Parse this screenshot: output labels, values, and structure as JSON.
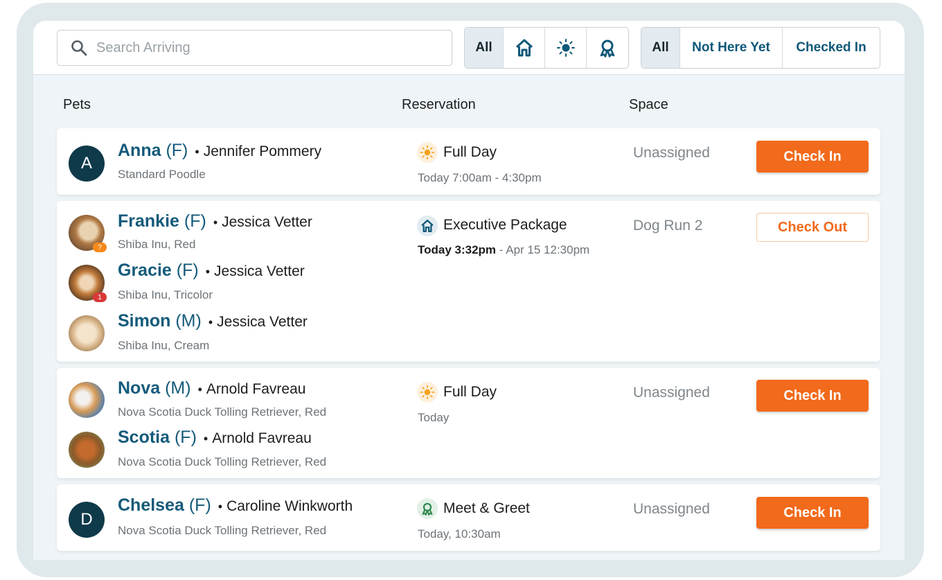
{
  "search": {
    "placeholder": "Search Arriving"
  },
  "type_filter": {
    "all_label": "All"
  },
  "status_filter": {
    "all_label": "All",
    "not_here_label": "Not Here Yet",
    "checked_in_label": "Checked In"
  },
  "columns": {
    "pets": "Pets",
    "reservation": "Reservation",
    "space": "Space"
  },
  "rows": [
    {
      "pets": [
        {
          "avatar_letter": "A",
          "name": "Anna",
          "sex": "(F)",
          "owner": "Jennifer Pommery",
          "breed": "Standard Poodle"
        }
      ],
      "reservation": {
        "icon": "sun-icon",
        "title": "Full Day",
        "time_bold": "",
        "time": "Today 7:00am - 4:30pm"
      },
      "space": "Unassigned",
      "action": "Check In"
    },
    {
      "pets": [
        {
          "name": "Frankie",
          "sex": "(F)",
          "owner": "Jessica Vetter",
          "breed": "Shiba Inu, Red",
          "badge": "?"
        },
        {
          "name": "Gracie",
          "sex": "(F)",
          "owner": "Jessica Vetter",
          "breed": "Shiba Inu, Tricolor",
          "badge": "1"
        },
        {
          "name": "Simon",
          "sex": "(M)",
          "owner": "Jessica Vetter",
          "breed": "Shiba Inu, Cream"
        }
      ],
      "reservation": {
        "icon": "house-icon",
        "title": "Executive Package",
        "time_bold": "Today 3:32pm",
        "time": " - Apr 15 12:30pm"
      },
      "space": "Dog Run 2",
      "action": "Check Out"
    },
    {
      "pets": [
        {
          "name": "Nova",
          "sex": "(M)",
          "owner": "Arnold Favreau",
          "breed": "Nova Scotia Duck Tolling Retriever, Red"
        },
        {
          "name": "Scotia",
          "sex": "(F)",
          "owner": "Arnold Favreau",
          "breed": "Nova Scotia Duck Tolling Retriever, Red"
        }
      ],
      "reservation": {
        "icon": "sun-icon",
        "title": "Full Day",
        "time_bold": "",
        "time": "Today"
      },
      "space": "Unassigned",
      "action": "Check In"
    },
    {
      "pets": [
        {
          "avatar_letter": "D",
          "name": "Chelsea",
          "sex": "(F)",
          "owner": "Caroline Winkworth",
          "breed": "Nova Scotia Duck Tolling Retriever, Red"
        }
      ],
      "reservation": {
        "icon": "ribbon-icon",
        "title": "Meet & Greet",
        "time_bold": "",
        "time": "Today, 10:30am"
      },
      "space": "Unassigned",
      "action": "Check In"
    }
  ],
  "colors": {
    "accent": "#f26a1b",
    "brand": "#145a7a",
    "avatar_dark": "#0f3a49"
  }
}
